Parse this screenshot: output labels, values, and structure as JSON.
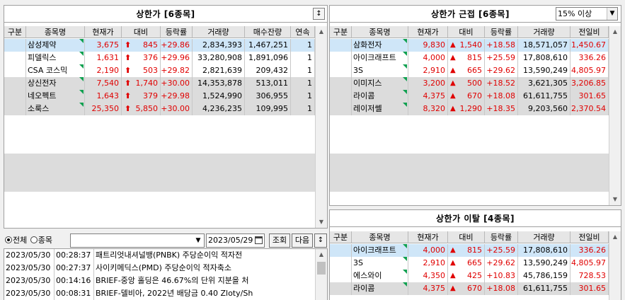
{
  "upper_limit": {
    "title": "상한가 [6종목]",
    "sort_icon": "updown-arrows-icon",
    "columns": [
      "구분",
      "종목명",
      "현재가",
      "대비",
      "등락률",
      "거래량",
      "매수잔량",
      "연속"
    ],
    "rows": [
      {
        "name": "삼성제약",
        "price": "3,675",
        "change": "845",
        "rate": "+29.86",
        "volume": "2,834,393",
        "bid": "1,467,251",
        "streak": "1"
      },
      {
        "name": "피델릭스",
        "price": "1,631",
        "change": "376",
        "rate": "+29.96",
        "volume": "33,280,908",
        "bid": "1,891,096",
        "streak": "1"
      },
      {
        "name": "CSA 코스믹",
        "price": "2,190",
        "change": "503",
        "rate": "+29.82",
        "volume": "2,821,639",
        "bid": "209,432",
        "streak": "1"
      },
      {
        "name": "상신전자",
        "price": "7,540",
        "change": "1,740",
        "rate": "+30.00",
        "volume": "14,353,878",
        "bid": "513,011",
        "streak": "1"
      },
      {
        "name": "네오펙트",
        "price": "1,643",
        "change": "379",
        "rate": "+29.98",
        "volume": "1,524,990",
        "bid": "306,955",
        "streak": "1"
      },
      {
        "name": "소룩스",
        "price": "25,350",
        "change": "5,850",
        "rate": "+30.00",
        "volume": "4,236,235",
        "bid": "109,995",
        "streak": "1"
      }
    ]
  },
  "near_upper": {
    "title": "상한가 근접 [6종목]",
    "filter_value": "15% 이상",
    "columns": [
      "구분",
      "종목명",
      "현재가",
      "대비",
      "등락률",
      "거래량",
      "전일비"
    ],
    "rows": [
      {
        "name": "삼화전자",
        "price": "9,830",
        "change": "1,540",
        "rate": "+18.58",
        "volume": "18,571,057",
        "prev": "1,450.67"
      },
      {
        "name": "아이크래프트",
        "price": "4,000",
        "change": "815",
        "rate": "+25.59",
        "volume": "17,808,610",
        "prev": "336.26"
      },
      {
        "name": "3S",
        "price": "2,910",
        "change": "665",
        "rate": "+29.62",
        "volume": "13,590,249",
        "prev": "4,805.97"
      },
      {
        "name": "이미지스",
        "price": "3,200",
        "change": "500",
        "rate": "+18.52",
        "volume": "3,621,305",
        "prev": "3,206.85"
      },
      {
        "name": "라이콤",
        "price": "4,375",
        "change": "670",
        "rate": "+18.08",
        "volume": "61,611,755",
        "prev": "301.65"
      },
      {
        "name": "레이저쎌",
        "price": "8,320",
        "change": "1,290",
        "rate": "+18.35",
        "volume": "9,203,560",
        "prev": "2,370.54"
      }
    ]
  },
  "off_upper": {
    "title": "상한가 이탈 [4종목]",
    "columns": [
      "구분",
      "종목명",
      "현재가",
      "대비",
      "등락률",
      "거래량",
      "전일비"
    ],
    "rows": [
      {
        "name": "아이크래프트",
        "price": "4,000",
        "change": "815",
        "rate": "+25.59",
        "volume": "17,808,610",
        "prev": "336.26"
      },
      {
        "name": "3S",
        "price": "2,910",
        "change": "665",
        "rate": "+29.62",
        "volume": "13,590,249",
        "prev": "4,805.97"
      },
      {
        "name": "에스와이",
        "price": "4,350",
        "change": "425",
        "rate": "+10.83",
        "volume": "45,786,159",
        "prev": "728.53"
      },
      {
        "name": "라이콤",
        "price": "4,375",
        "change": "670",
        "rate": "+18.08",
        "volume": "61,611,755",
        "prev": "301.65"
      }
    ]
  },
  "news": {
    "radio_all": "전체",
    "radio_stock": "종목",
    "date": "2023/05/29",
    "query_button": "조회",
    "next_button": "다음",
    "items": [
      {
        "date": "2023/05/30",
        "time": "00:28:37",
        "text": "패트리엇내셔널뱅(PNBK) 주당순이익 적자전"
      },
      {
        "date": "2023/05/30",
        "time": "00:27:37",
        "text": "사이키메딕스(PMD) 주당순이익 적자축소"
      },
      {
        "date": "2023/05/30",
        "time": "00:14:16",
        "text": "BRIEF-중앙 홀딩은 46.67%의 단위 지분을 처"
      },
      {
        "date": "2023/05/30",
        "time": "00:08:31",
        "text": "BRIEF-델비아, 2022년 배당금 0.40 Zloty/Sh"
      }
    ]
  },
  "colors": {
    "up": "#e00000",
    "selected": "#cfe6f8",
    "flag": "#10a050"
  }
}
